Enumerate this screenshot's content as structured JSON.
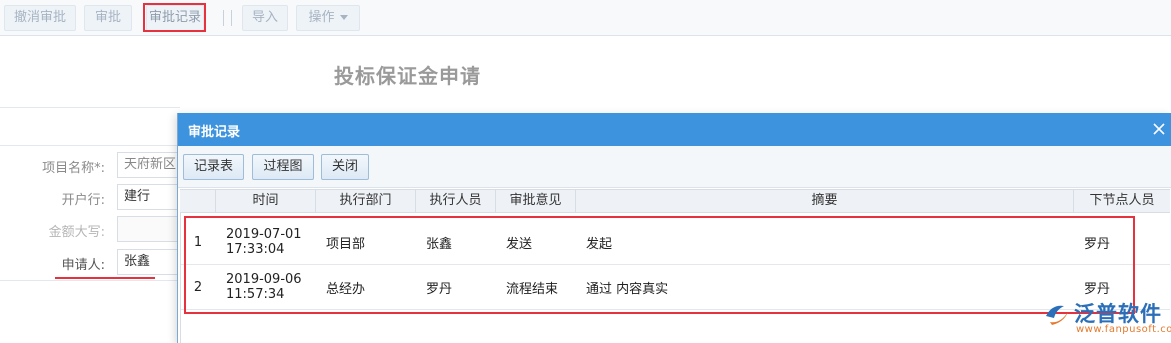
{
  "toolbar": {
    "revoke_label": "撤消审批",
    "approve_label": "审批",
    "records_label": "审批记录",
    "import_label": "导入",
    "operate_label": "操作"
  },
  "form": {
    "title": "投标保证金申请",
    "project_name_label": "项目名称*:",
    "project_name_value": "天府新区",
    "bank_label": "开户行:",
    "bank_value": "建行",
    "amount_upper_label": "金额大写:",
    "amount_upper_value": "",
    "applicant_label": "申请人:",
    "applicant_value": "张鑫"
  },
  "dialog": {
    "title": "审批记录",
    "buttons": {
      "record_table": "记录表",
      "process_chart": "过程图",
      "close": "关闭"
    },
    "columns": [
      "时间",
      "执行部门",
      "执行人员",
      "审批意见",
      "摘要",
      "下节点人员"
    ],
    "rows": [
      {
        "no": "1",
        "date": "2019-07-01",
        "time": "17:33:04",
        "dept": "项目部",
        "person": "张鑫",
        "opinion": "发送",
        "summary": "发起",
        "next": "罗丹"
      },
      {
        "no": "2",
        "date": "2019-09-06",
        "time": "11:57:34",
        "dept": "总经办",
        "person": "罗丹",
        "opinion": "流程结束",
        "summary": "通过 内容真实",
        "next": "罗丹"
      }
    ]
  },
  "logo": {
    "name": "泛普软件",
    "url": "www.fanpusoft.com"
  },
  "colors": {
    "dialog_header": "#3d93dd",
    "highlight_red": "#e5323e",
    "logo_blue": "#2b6fb9",
    "logo_orange": "#e57a2e"
  }
}
